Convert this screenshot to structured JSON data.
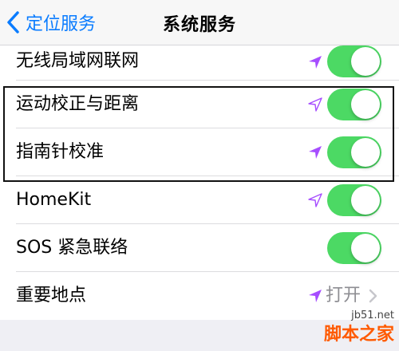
{
  "navbar": {
    "back_label": "定位服务",
    "title": "系统服务"
  },
  "rows": [
    {
      "label": "无线局域网联网",
      "arrow": "filled-purple",
      "toggle": "on"
    },
    {
      "label": "运动校正与距离",
      "arrow": "outline-purple",
      "toggle": "on"
    },
    {
      "label": "指南针校准",
      "arrow": "filled-purple",
      "toggle": "on"
    },
    {
      "label": "HomeKit",
      "arrow": "outline-purple",
      "toggle": "on"
    },
    {
      "label": "SOS 紧急联络",
      "toggle": "on"
    },
    {
      "label": "重要地点",
      "arrow": "filled-purple",
      "value": "打开"
    }
  ],
  "colors": {
    "accent_blue": "#0a7cff",
    "toggle_on": "#4cd964",
    "location_purple": "#a64dff",
    "highlight_border": "#111111"
  },
  "watermark": {
    "url": "jb51.net",
    "name": "脚本之家"
  }
}
